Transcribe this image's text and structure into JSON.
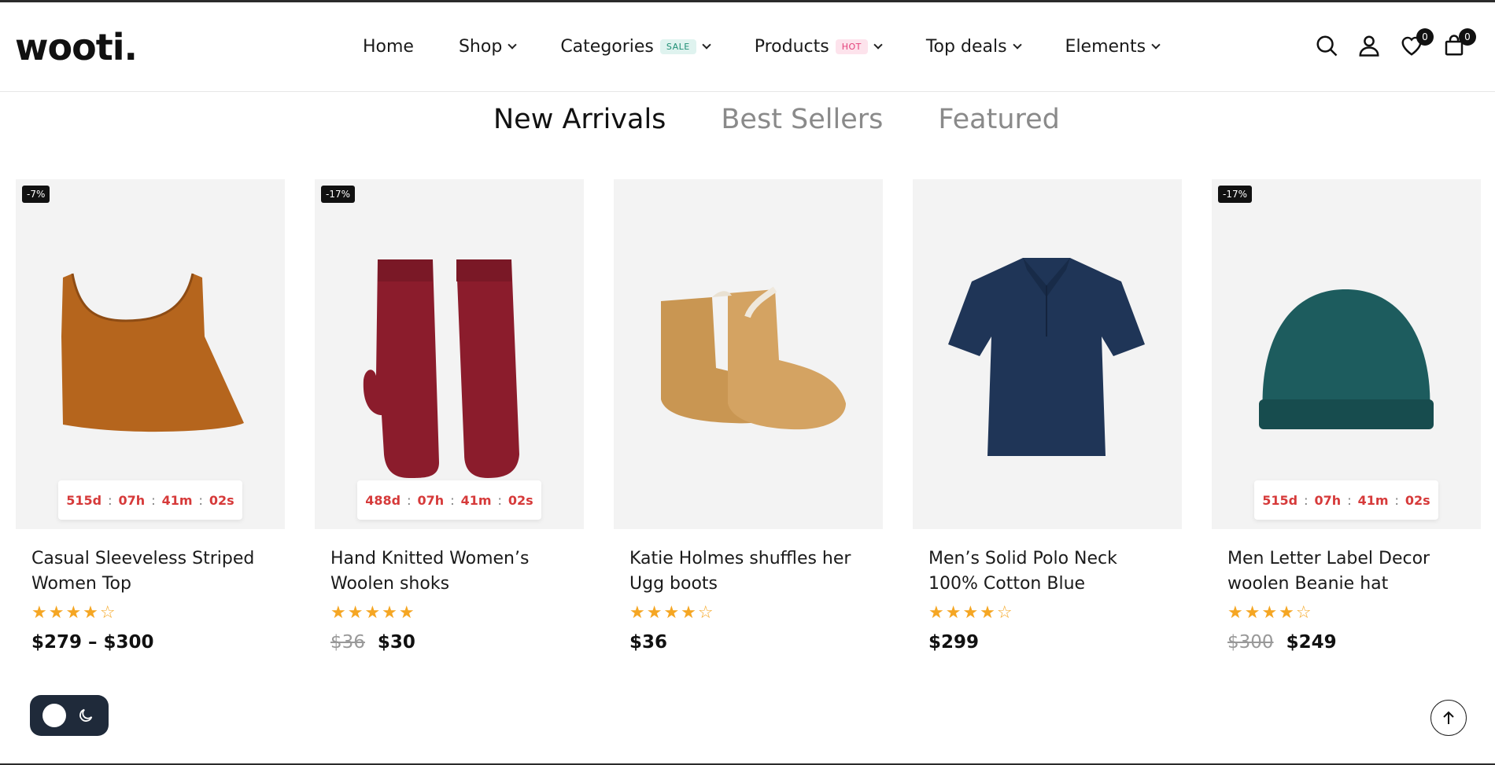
{
  "brand": {
    "logo": "wooti."
  },
  "nav": {
    "items": [
      {
        "label": "Home",
        "dropdown": false
      },
      {
        "label": "Shop",
        "dropdown": true
      },
      {
        "label": "Categories",
        "badge": "SALE",
        "dropdown": true
      },
      {
        "label": "Products",
        "badge": "HOT",
        "dropdown": true
      },
      {
        "label": "Top deals",
        "dropdown": true
      },
      {
        "label": "Elements",
        "dropdown": true
      }
    ]
  },
  "header_icons": {
    "search": "search-icon",
    "account": "user-icon",
    "wishlist": {
      "icon": "heart-icon",
      "count": "0"
    },
    "cart": {
      "icon": "bag-icon",
      "count": "0"
    }
  },
  "tabs": [
    {
      "label": "New Arrivals",
      "active": true
    },
    {
      "label": "Best Sellers",
      "active": false
    },
    {
      "label": "Featured",
      "active": false
    }
  ],
  "products": [
    {
      "title": "Casual Sleeveless Striped Women Top",
      "discount": "-7%",
      "timer": {
        "d": "515d",
        "h": "07h",
        "m": "41m",
        "s": "02s"
      },
      "stars": "★★★★☆",
      "old_price": "",
      "price": "$279 – $300",
      "image": "orange crop top",
      "color": "#b5651d"
    },
    {
      "title": "Hand Knitted Women’s Woolen shoks",
      "discount": "-17%",
      "timer": {
        "d": "488d",
        "h": "07h",
        "m": "41m",
        "s": "02s"
      },
      "stars": "★★★★★",
      "old_price": "$36",
      "price": "$30",
      "image": "burgundy mittens",
      "color": "#8b1c2c"
    },
    {
      "title": "Katie Holmes shuffles her Ugg boots",
      "discount": "",
      "timer": null,
      "stars": "★★★★☆",
      "old_price": "",
      "price": "$36",
      "image": "tan suede boots",
      "color": "#c99652"
    },
    {
      "title": "Men’s Solid Polo Neck 100% Cotton Blue",
      "discount": "",
      "timer": null,
      "stars": "★★★★☆",
      "old_price": "",
      "price": "$299",
      "image": "navy polo shirt",
      "color": "#1f3557"
    },
    {
      "title": "Men Letter Label Decor woolen Beanie hat",
      "discount": "-17%",
      "timer": {
        "d": "515d",
        "h": "07h",
        "m": "41m",
        "s": "02s"
      },
      "stars": "★★★★☆",
      "old_price": "$300",
      "price": "$249",
      "image": "teal beanie",
      "color": "#1d5c5e"
    }
  ],
  "colors": {
    "accent_red": "#d63a3a",
    "star": "#f5a623",
    "dark": "#111111",
    "toggle_bg": "#1f2a3a"
  },
  "widgets": {
    "theme_toggle": "moon-icon",
    "scroll_top": "arrow-up-icon"
  }
}
